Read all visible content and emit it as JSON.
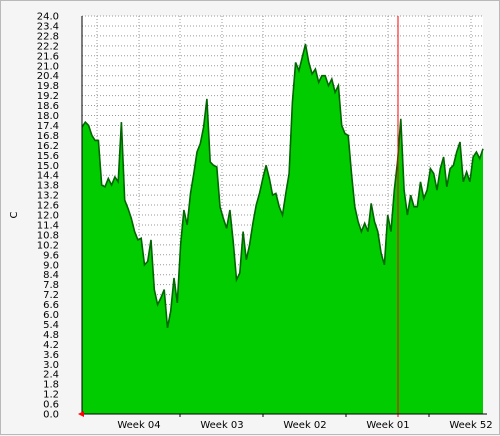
{
  "chart_data": {
    "type": "area",
    "title": "",
    "xlabel": "",
    "ylabel": "C",
    "ylim": [
      0,
      24.0
    ],
    "grid": true,
    "x_tick_labels": [
      "Week 04",
      "Week 03",
      "Week 02",
      "Week 01",
      "Week 52"
    ],
    "y_tick_labels": [
      "0.0",
      "0.6",
      "1.2",
      "1.8",
      "2.4",
      "3.0",
      "3.6",
      "4.2",
      "4.8",
      "5.4",
      "6.0",
      "6.6",
      "7.2",
      "7.8",
      "8.4",
      "9.0",
      "9.6",
      "10.2",
      "10.8",
      "11.4",
      "12.0",
      "12.6",
      "13.2",
      "13.8",
      "14.4",
      "15.0",
      "15.6",
      "16.2",
      "16.8",
      "17.4",
      "18.0",
      "18.6",
      "19.2",
      "19.8",
      "20.4",
      "21.0",
      "21.6",
      "22.2",
      "22.8",
      "23.4",
      "24.0"
    ],
    "colors": {
      "fill": "#00cc00",
      "outline": "#006600",
      "marker": "#ff0000",
      "grid": "#999999",
      "plot_bg": "#ffffff"
    },
    "values": [
      17.3,
      17.6,
      17.4,
      16.8,
      16.5,
      16.5,
      13.8,
      13.7,
      14.2,
      13.8,
      14.3,
      14.0,
      17.6,
      12.9,
      12.4,
      11.8,
      11.0,
      10.5,
      10.6,
      9.0,
      9.2,
      10.5,
      7.5,
      6.6,
      7.0,
      7.5,
      5.2,
      6.2,
      8.2,
      6.7,
      10.2,
      12.3,
      11.4,
      13.3,
      14.5,
      15.8,
      16.3,
      17.3,
      19.0,
      15.2,
      15.0,
      14.9,
      12.5,
      11.8,
      11.2,
      12.3,
      10.4,
      8.1,
      8.5,
      11.0,
      9.3,
      10.2,
      11.5,
      12.6,
      13.3,
      14.2,
      15.0,
      14.2,
      13.2,
      13.3,
      12.5,
      12.0,
      13.3,
      14.5,
      18.8,
      21.2,
      20.7,
      21.5,
      22.3,
      21.2,
      20.5,
      20.8,
      20.0,
      20.4,
      20.4,
      19.8,
      20.2,
      19.4,
      19.8,
      17.4,
      16.9,
      16.8,
      14.5,
      12.5,
      11.6,
      11.0,
      11.5,
      11.0,
      12.7,
      11.6,
      11.0,
      9.7,
      9.0,
      12.0,
      11.0,
      13.5,
      15.2,
      17.8,
      13.5,
      12.0,
      13.2,
      12.5,
      12.5,
      14.0,
      13.0,
      13.5,
      14.8,
      14.5,
      13.5,
      14.8,
      15.5,
      13.7,
      14.8,
      15.0,
      15.8,
      16.4,
      14.0,
      14.6,
      14.0,
      15.5,
      15.8,
      15.4,
      16.0
    ]
  }
}
